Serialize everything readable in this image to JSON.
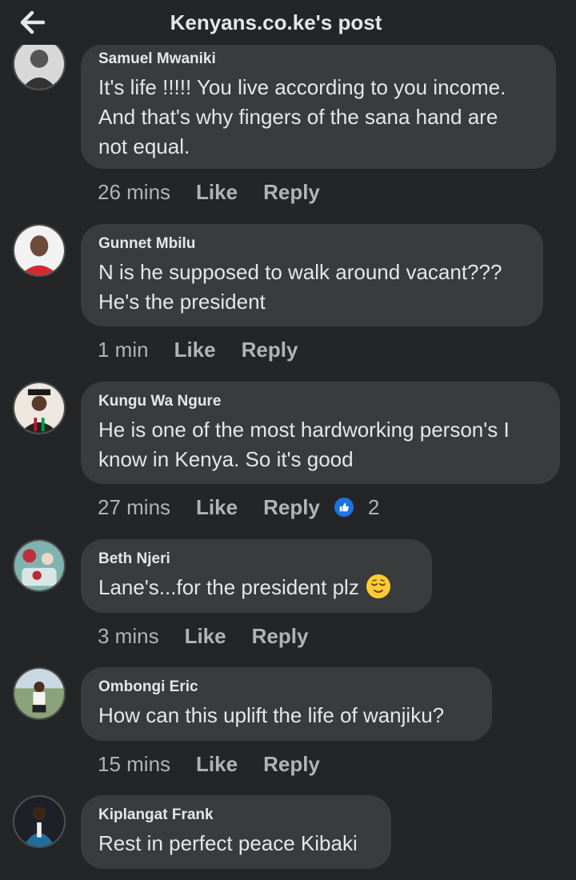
{
  "header": {
    "title": "Kenyans.co.ke's post",
    "back_icon": "arrow-left-icon"
  },
  "comments": [
    {
      "author": "Samuel Mwaniki",
      "text_lines": [
        "It's life !!!!! You live according to you income.",
        "And  that's why fingers of the sana hand are",
        "not equal."
      ],
      "time": "26 mins",
      "like": "Like",
      "reply": "Reply"
    },
    {
      "author": "Gunnet Mbilu",
      "text_lines": [
        "N is he supposed to walk around vacant???",
        "He's the president"
      ],
      "time": "1 min",
      "like": "Like",
      "reply": "Reply"
    },
    {
      "author": "Kungu Wa Ngure",
      "text_lines": [
        "He is one of the most hardworking person's I",
        "know in Kenya. So it's good"
      ],
      "time": "27 mins",
      "like": "Like",
      "reply": "Reply",
      "reaction_count": "2"
    },
    {
      "author": "Beth Njeri",
      "text_lines": [
        "Lane's...for the president plz"
      ],
      "emoji": "relieved-face-emoji",
      "time": "3 mins",
      "like": "Like",
      "reply": "Reply"
    },
    {
      "author": "Ombongi Eric",
      "text_lines": [
        "How can this uplift the life of wanjiku?"
      ],
      "time": "15 mins",
      "like": "Like",
      "reply": "Reply"
    },
    {
      "author": "Kiplangat Frank",
      "text_lines": [
        "Rest in perfect peace Kibaki"
      ]
    }
  ],
  "colors": {
    "background": "#242526",
    "bubble": "#3a3b3c",
    "primary_text": "#e4e6eb",
    "secondary_text": "#b0b3b8",
    "like_badge": "#1b74e4"
  }
}
